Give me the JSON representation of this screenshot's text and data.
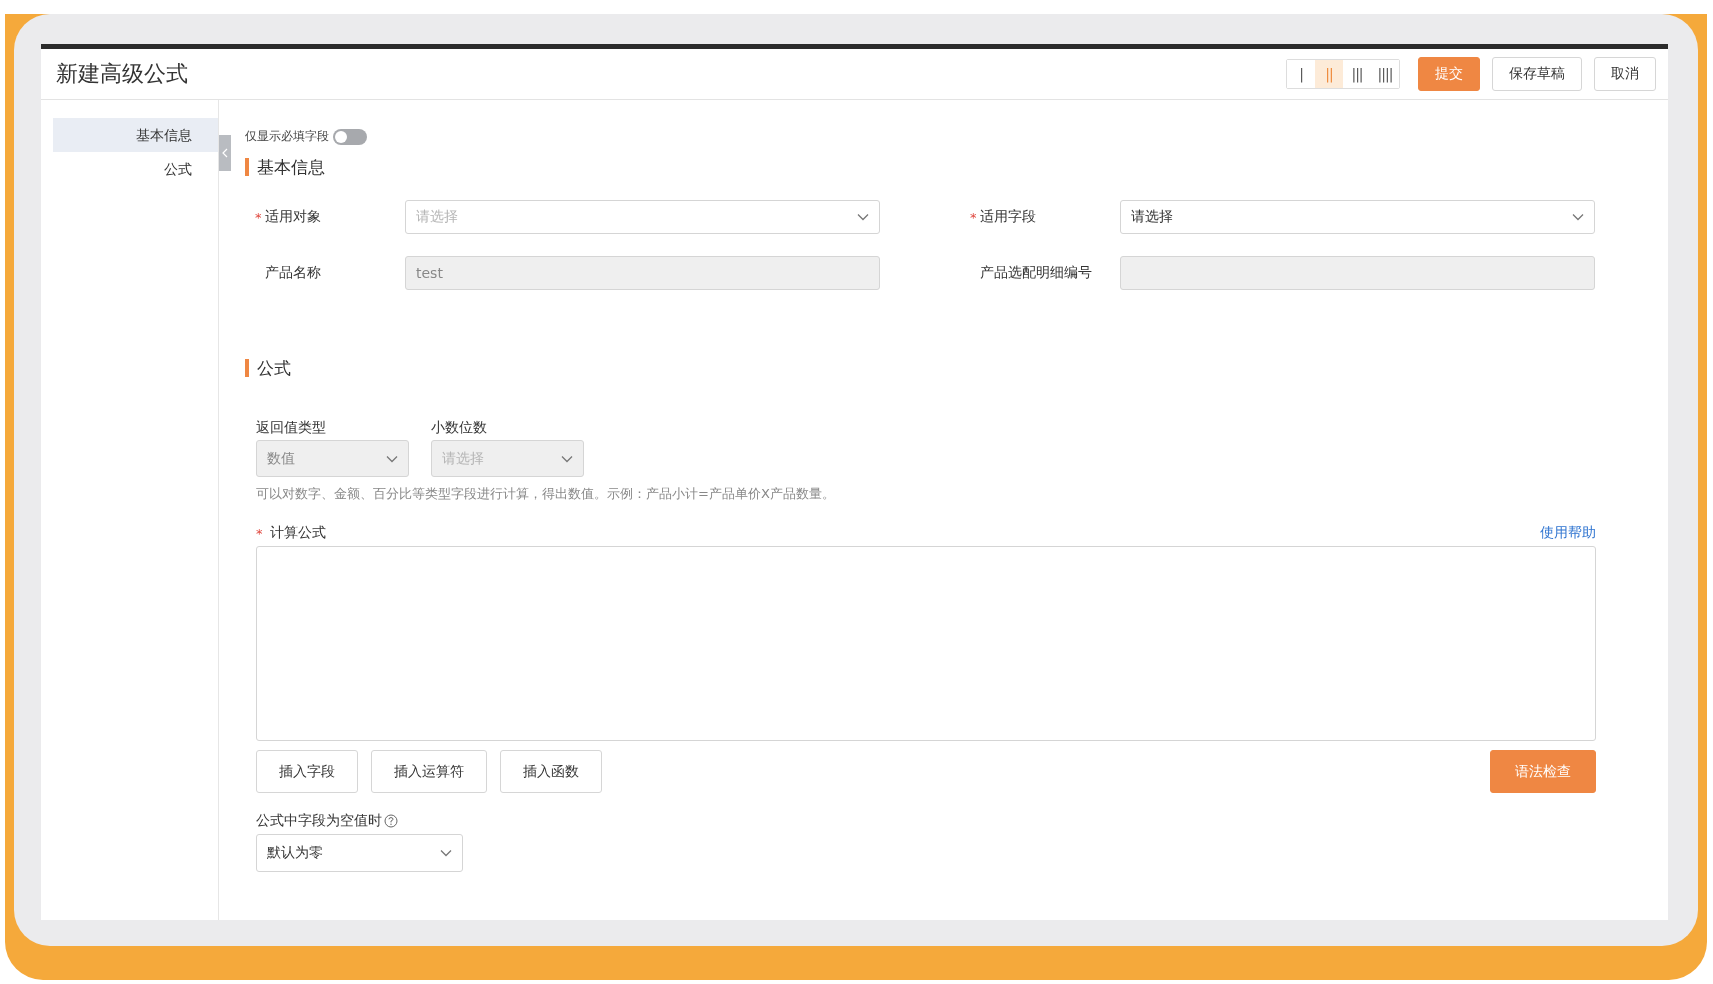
{
  "window": {
    "title": "新建高级公式"
  },
  "layout_options": [
    {
      "label": "|",
      "selected": false
    },
    {
      "label": "||",
      "selected": true
    },
    {
      "label": "|||",
      "selected": false
    },
    {
      "label": "||||",
      "selected": false
    }
  ],
  "header_buttons": [
    {
      "label": "提交",
      "kind": "primary"
    },
    {
      "label": "保存草稿",
      "kind": "default"
    },
    {
      "label": "取消",
      "kind": "default"
    }
  ],
  "sidebar": {
    "items": [
      {
        "label": "基本信息",
        "selected": true
      },
      {
        "label": "公式",
        "selected": false
      }
    ]
  },
  "required_toggle": {
    "label": "仅显示必填字段",
    "on": false
  },
  "sections": [
    {
      "title": "基本信息",
      "fields": [
        {
          "label": "适用对象",
          "kind": "select",
          "required_mark": "*",
          "placeholder": "请选择"
        },
        {
          "label": "适用字段",
          "kind": "select",
          "required_mark": "*",
          "value": "请选择"
        },
        {
          "label": "产品名称",
          "kind": "text",
          "disabled": true,
          "value": "test"
        },
        {
          "label": "产品选配明细编号",
          "kind": "text",
          "disabled": true
        }
      ]
    },
    {
      "title": "公式",
      "return_type": {
        "label": "返回值类型",
        "disabled": true,
        "value": "数值"
      },
      "decimals": {
        "label": "小数位数",
        "disabled": true,
        "placeholder": "请选择"
      },
      "hint": "可以对数字、金额、百分比等类型字段进行计算，得出数值。示例：产品小计=产品单价X产品数量。",
      "formula": {
        "label": "计算公式",
        "required_mark": "*",
        "help_link": "使用帮助"
      },
      "insert_buttons": [
        {
          "label": "插入字段"
        },
        {
          "label": "插入运算符"
        },
        {
          "label": "插入函数"
        }
      ],
      "check_button": {
        "label": "语法检查"
      },
      "null_handling": {
        "label": "公式中字段为空值时",
        "value": "默认为零"
      }
    }
  ]
}
